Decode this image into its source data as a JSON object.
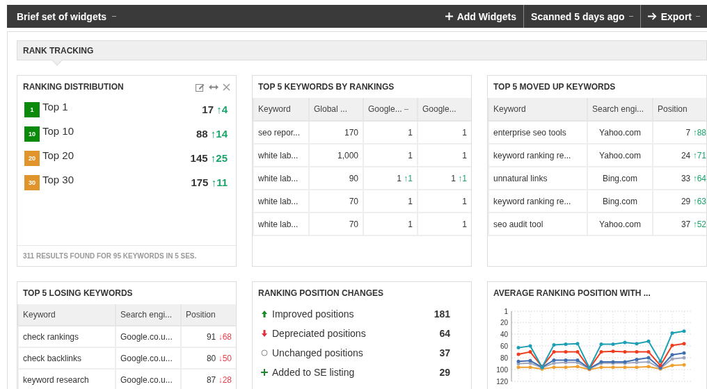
{
  "toolbar": {
    "title": "Brief set of widgets",
    "add_widgets": "Add Widgets",
    "scanned": "Scanned 5 days ago",
    "export": "Export"
  },
  "section": {
    "title": "RANK TRACKING"
  },
  "ranking_distribution": {
    "title": "RANKING DISTRIBUTION",
    "items": [
      {
        "badge": "1",
        "color": "#0a8a0a",
        "label": "Top 1",
        "count": "17",
        "change": "↑4"
      },
      {
        "badge": "10",
        "color": "#0a8a0a",
        "label": "Top 10",
        "count": "88",
        "change": "↑14"
      },
      {
        "badge": "20",
        "color": "#e0952c",
        "label": "Top 20",
        "count": "145",
        "change": "↑25"
      },
      {
        "badge": "30",
        "color": "#e0952c",
        "label": "Top 30",
        "count": "175",
        "change": "↑11"
      }
    ],
    "footer": "311 RESULTS FOUND FOR 95 KEYWORDS IN 5 SES."
  },
  "top_keywords": {
    "title": "TOP 5 KEYWORDS BY RANKINGS",
    "columns": [
      {
        "label": "Keyword",
        "sorted": false
      },
      {
        "label": "Global ...",
        "sorted": false
      },
      {
        "label": "Google...",
        "sorted": true
      },
      {
        "label": "Google...",
        "sorted": false
      }
    ],
    "rows": [
      {
        "keyword": "seo repor...",
        "global": "170",
        "g1": {
          "value": "1"
        },
        "g2": {
          "value": "1"
        }
      },
      {
        "keyword": "white lab...",
        "global": "1,000",
        "g1": {
          "value": "1"
        },
        "g2": {
          "value": "1"
        }
      },
      {
        "keyword": "white lab...",
        "global": "90",
        "g1": {
          "value": "1",
          "change": "↑1",
          "color": "#1aa46a"
        },
        "g2": {
          "value": "1",
          "change": "↑1",
          "color": "#1aa46a"
        }
      },
      {
        "keyword": "white lab...",
        "global": "70",
        "g1": {
          "value": "1"
        },
        "g2": {
          "value": "1"
        }
      },
      {
        "keyword": "white lab...",
        "global": "70",
        "g1": {
          "value": "1"
        },
        "g2": {
          "value": "1"
        }
      }
    ]
  },
  "moved_up": {
    "title": "TOP 5 MOVED UP KEYWORDS",
    "columns": [
      "Keyword",
      "Search engi...",
      "Position"
    ],
    "rows": [
      {
        "keyword": "enterprise seo tools",
        "engine": "Yahoo.com",
        "position": {
          "value": "7",
          "change": "↑88",
          "color": "#1aa46a"
        }
      },
      {
        "keyword": "keyword ranking re...",
        "engine": "Yahoo.com",
        "position": {
          "value": "24",
          "change": "↑71",
          "color": "#1aa46a"
        }
      },
      {
        "keyword": "unnatural links",
        "engine": "Bing.com",
        "position": {
          "value": "33",
          "change": "↑64",
          "color": "#1aa46a"
        }
      },
      {
        "keyword": "keyword ranking re...",
        "engine": "Bing.com",
        "position": {
          "value": "29",
          "change": "↑63",
          "color": "#1aa46a"
        }
      },
      {
        "keyword": "seo audit tool",
        "engine": "Yahoo.com",
        "position": {
          "value": "37",
          "change": "↑52",
          "color": "#1aa46a"
        }
      }
    ]
  },
  "losing": {
    "title": "TOP 5 LOSING KEYWORDS",
    "columns": [
      "Keyword",
      "Search engi...",
      "Position"
    ],
    "rows": [
      {
        "keyword": "check rankings",
        "engine": "Google.co.u...",
        "position": {
          "value": "91",
          "change": "↓68",
          "color": "#e8404a"
        }
      },
      {
        "keyword": "check backlinks",
        "engine": "Google.co.u...",
        "position": {
          "value": "80",
          "change": "↓50",
          "color": "#e8404a"
        }
      },
      {
        "keyword": "keyword research",
        "engine": "Google.co.u...",
        "position": {
          "value": "87",
          "change": "↓28",
          "color": "#e8404a"
        }
      }
    ]
  },
  "position_changes": {
    "title": "RANKING POSITION CHANGES",
    "items": [
      {
        "kind": "improved",
        "label": "Improved positions",
        "count": "181"
      },
      {
        "kind": "depreciated",
        "label": "Depreciated positions",
        "count": "64"
      },
      {
        "kind": "unchanged",
        "label": "Unchanged positions",
        "count": "37"
      },
      {
        "kind": "added",
        "label": "Added to SE listing",
        "count": "29"
      }
    ]
  },
  "average_position": {
    "title": "AVERAGE RANKING POSITION WITH ...",
    "chart_data": {
      "type": "line",
      "grid": true,
      "ylim": [
        120,
        1
      ],
      "yticks": [
        1,
        20,
        40,
        60,
        80,
        100,
        120
      ],
      "series": [
        {
          "color": "#1b9fb4",
          "values": [
            63,
            60,
            96,
            58,
            57,
            56,
            97,
            57,
            57,
            54,
            56,
            52,
            86,
            38,
            35
          ]
        },
        {
          "color": "#f03c1e",
          "values": [
            74,
            70,
            95,
            70,
            70,
            70,
            98,
            70,
            69,
            70,
            70,
            70,
            93,
            59,
            56
          ]
        },
        {
          "color": "#3f6fb0",
          "values": [
            86,
            85,
            96,
            84,
            84,
            84,
            98,
            87,
            87,
            87,
            83,
            80,
            97,
            75,
            72
          ]
        },
        {
          "color": "#a0a8c0",
          "values": [
            90,
            89,
            97,
            89,
            88,
            88,
            99,
            89,
            89,
            89,
            88,
            87,
            98,
            82,
            80
          ]
        },
        {
          "color": "#f0a030",
          "values": [
            96,
            96,
            99,
            96,
            96,
            95,
            100,
            96,
            96,
            96,
            96,
            95,
            99,
            93,
            92
          ]
        }
      ]
    }
  }
}
